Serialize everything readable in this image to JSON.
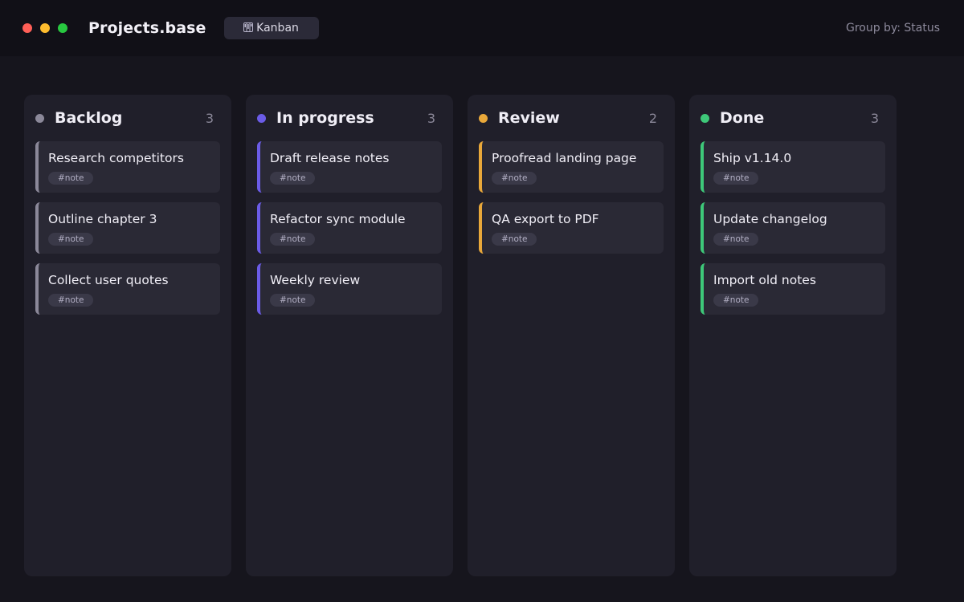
{
  "window": {
    "title": "Projects.base",
    "controls": [
      {
        "name": "close",
        "color": "#ff5f57"
      },
      {
        "name": "minimize",
        "color": "#febc2e"
      },
      {
        "name": "maximize",
        "color": "#28c840"
      }
    ]
  },
  "view_tab": {
    "icon": "kanban-icon",
    "label": "Kanban"
  },
  "group_by": "Group by: Status",
  "columns": [
    {
      "title": "Backlog",
      "count": "3",
      "color": "#8b8899",
      "cards": [
        {
          "title": "Research competitors",
          "tag": "#note"
        },
        {
          "title": "Outline chapter 3",
          "tag": "#note"
        },
        {
          "title": "Collect user quotes",
          "tag": "#note"
        }
      ]
    },
    {
      "title": "In progress",
      "count": "3",
      "color": "#6b5ce7",
      "cards": [
        {
          "title": "Draft release notes",
          "tag": "#note"
        },
        {
          "title": "Refactor sync module",
          "tag": "#note"
        },
        {
          "title": "Weekly review",
          "tag": "#note"
        }
      ]
    },
    {
      "title": "Review",
      "count": "2",
      "color": "#e9a83a",
      "cards": [
        {
          "title": "Proofread landing page",
          "tag": "#note"
        },
        {
          "title": "QA export to PDF",
          "tag": "#note"
        }
      ]
    },
    {
      "title": "Done",
      "count": "3",
      "color": "#3ec879",
      "cards": [
        {
          "title": "Ship v1.14.0",
          "tag": "#note"
        },
        {
          "title": "Update changelog",
          "tag": "#note"
        },
        {
          "title": "Import old notes",
          "tag": "#note"
        }
      ]
    }
  ]
}
